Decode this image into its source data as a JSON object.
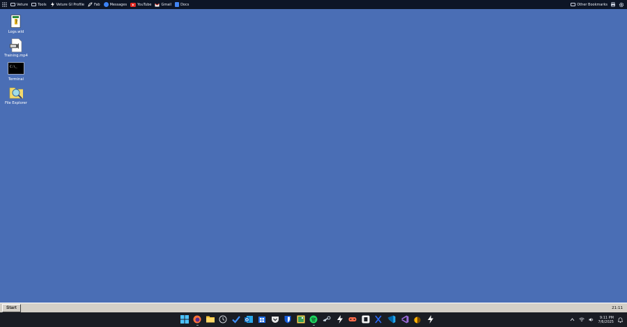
{
  "bookmarks": {
    "items": [
      {
        "label": "Veture",
        "icon": "folder-icon"
      },
      {
        "label": "Tools",
        "icon": "folder-icon"
      },
      {
        "label": "Veture GI Profile",
        "icon": "veture-icon"
      },
      {
        "label": "Fab",
        "icon": "fab-icon"
      },
      {
        "label": "Messages",
        "icon": "messages-icon"
      },
      {
        "label": "YouTube",
        "icon": "youtube-icon"
      },
      {
        "label": "Gmail",
        "icon": "gmail-icon"
      },
      {
        "label": "Docs",
        "icon": "docs-icon"
      }
    ],
    "other_bookmarks": "Other Bookmarks"
  },
  "desktop": {
    "icons": [
      {
        "label": "Logs.wld",
        "icon": "script-file-icon"
      },
      {
        "label": "Training.mp4",
        "icon": "video-file-icon"
      },
      {
        "label": "Terminal",
        "icon": "terminal-icon",
        "glyph": "C:\\_"
      },
      {
        "label": "File Explorer",
        "icon": "file-explorer-icon"
      }
    ]
  },
  "old_taskbar": {
    "start_label": "Start",
    "clock": "21:11"
  },
  "taskbar": {
    "apps": [
      "windows-start-icon",
      "firefox-icon",
      "file-explorer-icon",
      "clock-app-icon",
      "todo-icon",
      "outlook-icon",
      "store-icon",
      "pocket-icon",
      "bitwarden-icon",
      "photos-icon",
      "spotify-icon",
      "steam-icon",
      "veture-icon",
      "game-icon",
      "obsidian-icon",
      "unreal-icon",
      "vscode-icon",
      "visual-studio-icon",
      "tor-icon",
      "veture-app-icon"
    ],
    "time": "9:11 PM",
    "date": "7/6/2025"
  },
  "colors": {
    "desktop": "#4a6eb5",
    "taskbar": "#1a1d24",
    "bookmarks_bar": "#0d1526"
  }
}
